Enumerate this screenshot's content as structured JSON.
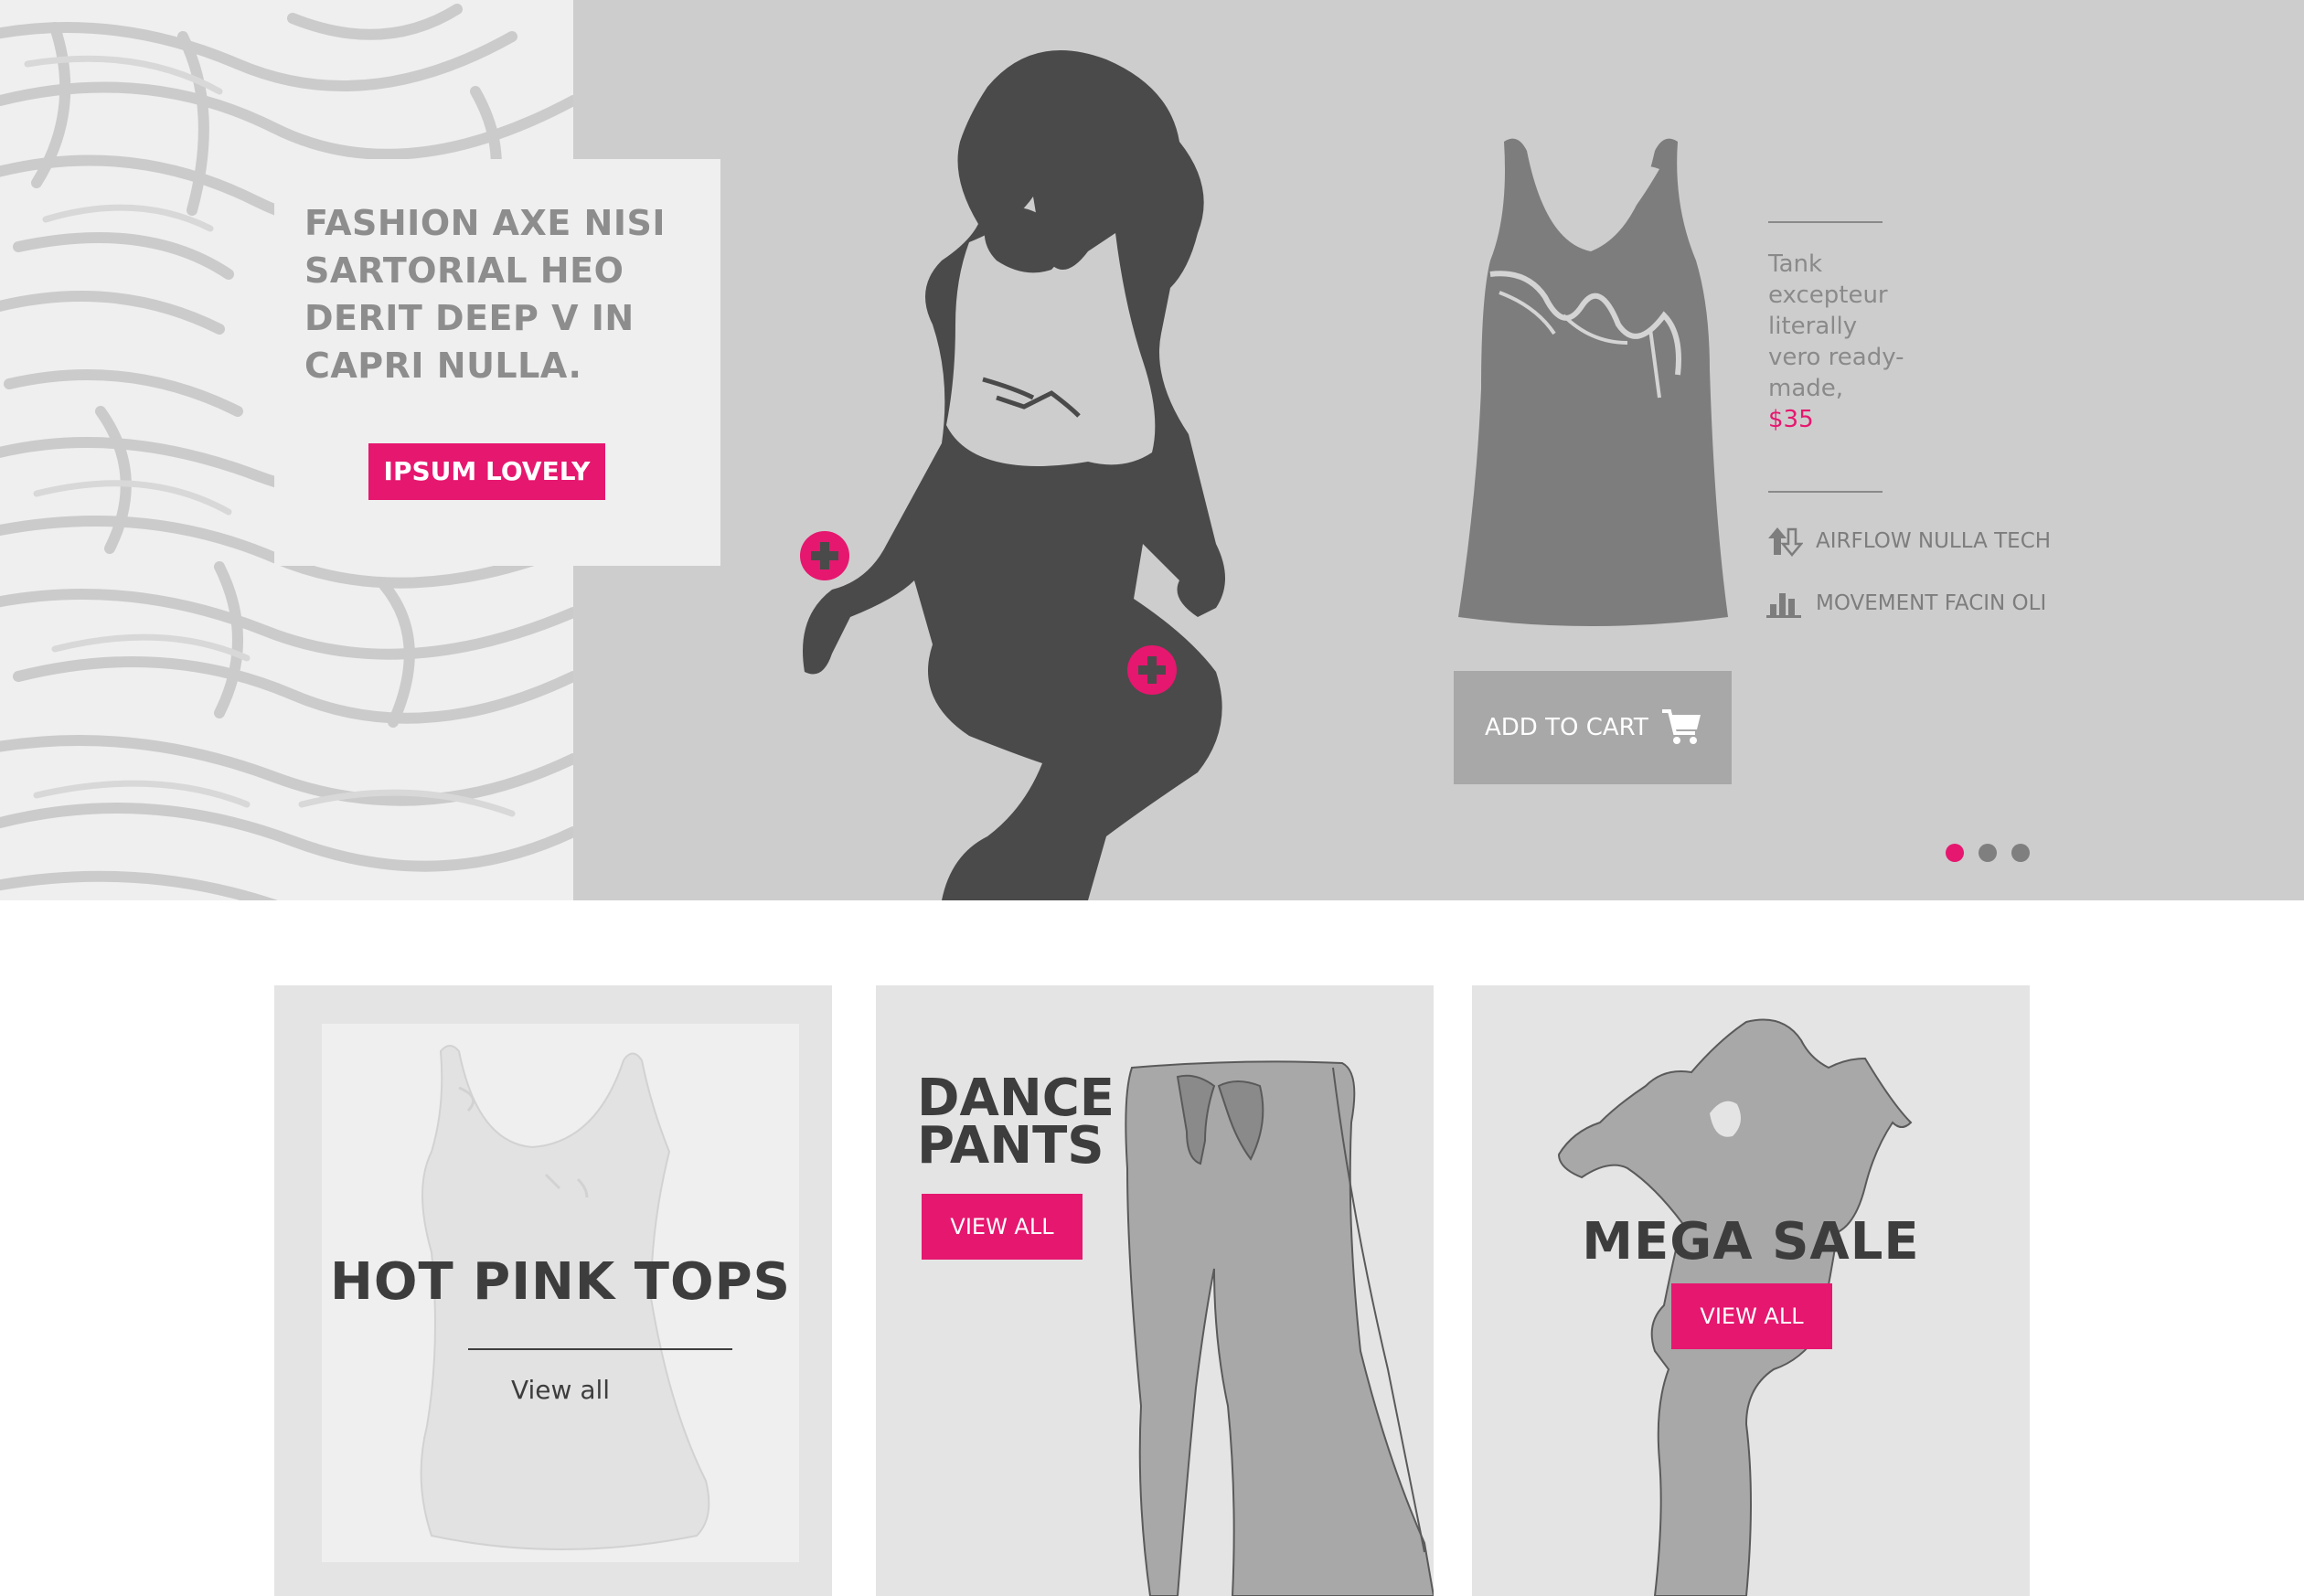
{
  "hero": {
    "promo_title": "FASHION AXE NISI SARTORIAL HEO DERIT DEEP V IN CAPRI NULLA.",
    "promo_button": "IPSUM LOVELY",
    "product": {
      "description": "Tank excepteur literally vero ready-made,",
      "price": "$35",
      "features": [
        {
          "icon": "arrows-up-down-icon",
          "label": "AIRFLOW NULLA TECH"
        },
        {
          "icon": "bar-chart-icon",
          "label": "MOVEMENT FACIN OLI"
        }
      ],
      "add_to_cart": "ADD TO CART"
    },
    "carousel": {
      "total": 3,
      "active": 1
    }
  },
  "cards": [
    {
      "title": "HOT PINK TOPS",
      "link": "View all"
    },
    {
      "title_line1": "DANCE",
      "title_line2": "PANTS",
      "button": "VIEW ALL"
    },
    {
      "title": "MEGA SALE",
      "button": "VIEW ALL"
    }
  ],
  "colors": {
    "accent": "#e6176f",
    "hero_bg": "#cdcdcd",
    "silhouette": "#4a4a4a",
    "card_bg": "#e4e4e4"
  }
}
